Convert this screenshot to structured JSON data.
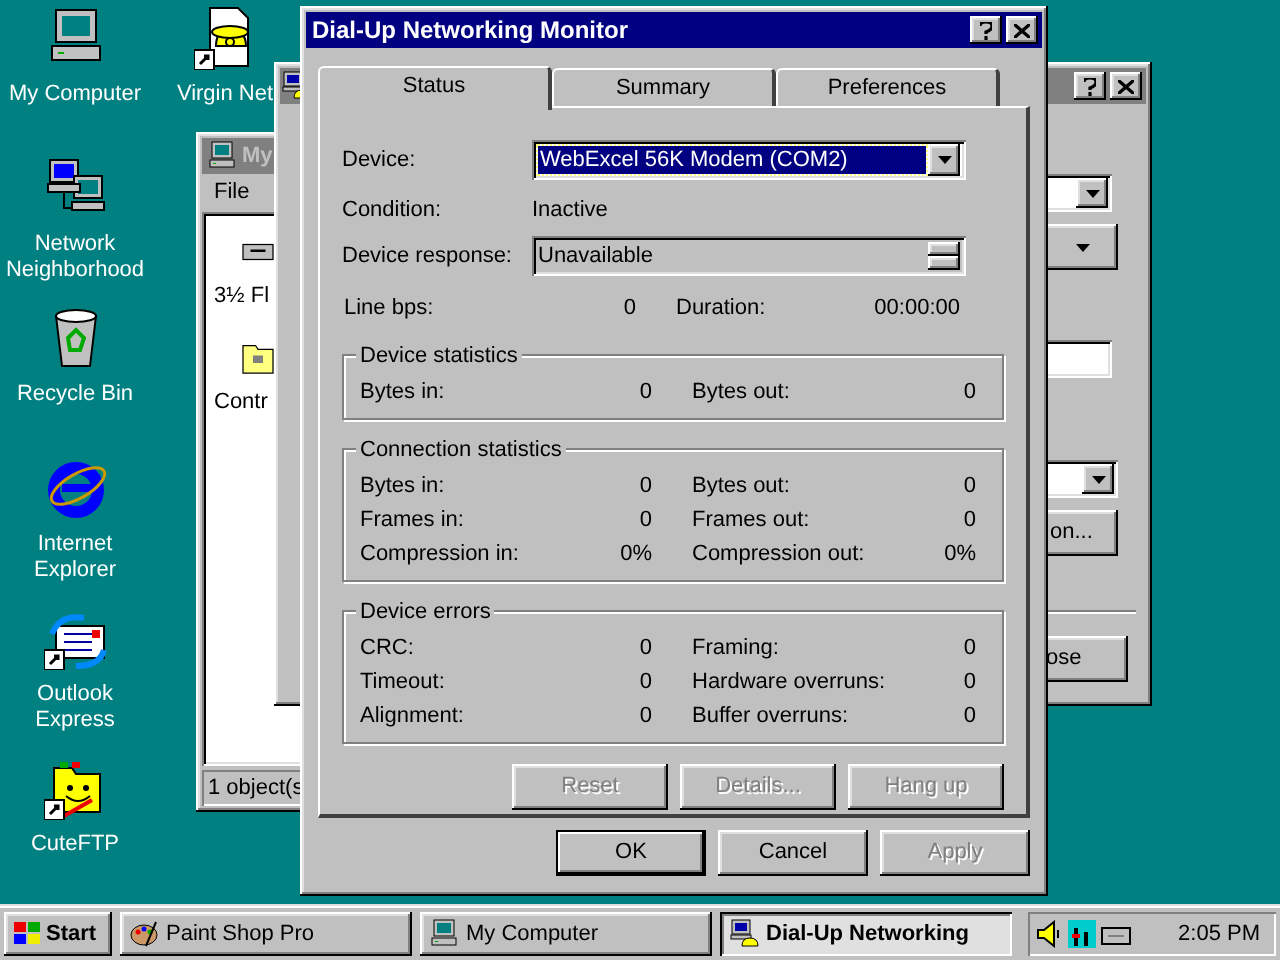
{
  "desktop_icons": [
    {
      "kind": "computer",
      "label": "My Computer",
      "shortcut": false
    },
    {
      "kind": "phone",
      "label": "Virgin Net",
      "shortcut": true
    },
    {
      "kind": "network",
      "label": "Network Neighborhood",
      "shortcut": false
    },
    {
      "kind": "recycle",
      "label": "Recycle Bin",
      "shortcut": false
    },
    {
      "kind": "browser",
      "label": "Internet Explorer",
      "shortcut": false
    },
    {
      "kind": "mail",
      "label": "Outlook Express",
      "shortcut": true
    },
    {
      "kind": "ftp",
      "label": "CuteFTP",
      "shortcut": true
    }
  ],
  "explorer_window": {
    "title": "My",
    "menu": [
      "File"
    ],
    "items": [
      {
        "kind": "floppy",
        "label": "3½ Fl"
      },
      {
        "kind": "folder",
        "label": "Contr"
      }
    ],
    "status": "1 object(s"
  },
  "back_dialog": {
    "buttons": [
      "on...",
      "ose"
    ]
  },
  "dialog": {
    "title": "Dial-Up Networking Monitor",
    "tabs": [
      {
        "label": "Status",
        "selected": true
      },
      {
        "label": "Summary",
        "selected": false
      },
      {
        "label": "Preferences",
        "selected": false
      }
    ],
    "device": {
      "label": "Device:",
      "value": "WebExcel 56K Modem (COM2)"
    },
    "condition": {
      "label": "Condition:",
      "value": "Inactive"
    },
    "response": {
      "label": "Device response:",
      "value": "Unavailable"
    },
    "line": {
      "label": "Line bps:",
      "value": "0",
      "label_2": "Duration:",
      "value_2": "00:00:00"
    },
    "groups": [
      {
        "title": "Device statistics",
        "rows": [
          {
            "label": "Bytes in:",
            "value": "0",
            "label_2": "Bytes out:",
            "value_2": "0"
          }
        ]
      },
      {
        "title": "Connection statistics",
        "rows": [
          {
            "label": "Bytes in:",
            "value": "0",
            "label_2": "Bytes out:",
            "value_2": "0"
          },
          {
            "label": "Frames in:",
            "value": "0",
            "label_2": "Frames out:",
            "value_2": "0"
          },
          {
            "label": "Compression in:",
            "value": "0%",
            "label_2": "Compression out:",
            "value_2": "0%"
          }
        ]
      },
      {
        "title": "Device errors",
        "rows": [
          {
            "label": "CRC:",
            "value": "0",
            "label_2": "Framing:",
            "value_2": "0"
          },
          {
            "label": "Timeout:",
            "value": "0",
            "label_2": "Hardware overruns:",
            "value_2": "0"
          },
          {
            "label": "Alignment:",
            "value": "0",
            "label_2": "Buffer overruns:",
            "value_2": "0"
          }
        ]
      }
    ],
    "actions": [
      {
        "label": "Reset",
        "disabled": true
      },
      {
        "label": "Details...",
        "disabled": true
      },
      {
        "label": "Hang up",
        "disabled": true
      }
    ],
    "buttons": [
      {
        "label": "OK",
        "default": true,
        "disabled": false
      },
      {
        "label": "Cancel",
        "default": false,
        "disabled": false
      },
      {
        "label": "Apply",
        "default": false,
        "disabled": true
      }
    ]
  },
  "taskbar": {
    "start": "Start",
    "tasks": [
      {
        "kind": "paint",
        "label": "Paint Shop Pro",
        "selected": false
      },
      {
        "kind": "computer",
        "label": "My Computer",
        "selected": false
      },
      {
        "kind": "dialup",
        "label": "Dial-Up Networking",
        "selected": true
      }
    ],
    "clock": "2:05 PM"
  }
}
